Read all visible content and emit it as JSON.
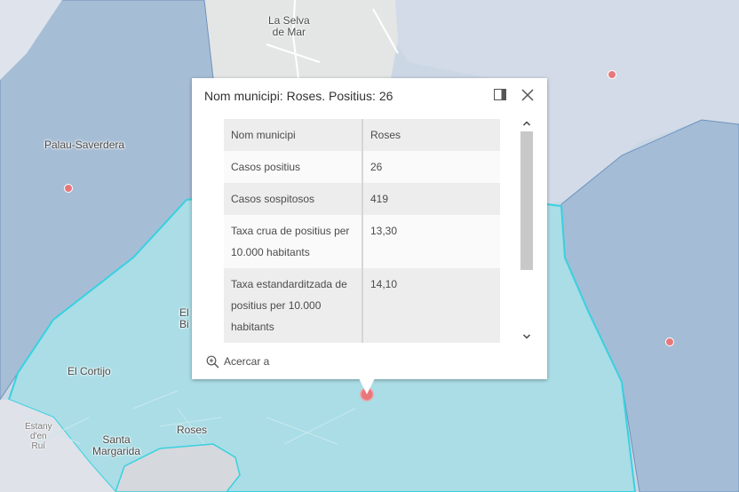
{
  "map": {
    "places": [
      {
        "id": "la-selva-de-mar",
        "name": "La Selva\nde Mar"
      },
      {
        "id": "palau-saverdera",
        "name": "Palau-Saverdera"
      },
      {
        "id": "el-cortijo",
        "name": "El Cortijo"
      },
      {
        "id": "santa-margarida",
        "name": "Santa\nMargarida"
      },
      {
        "id": "roses",
        "name": "Roses"
      },
      {
        "id": "estany-den-rui",
        "name": "Estany\nd'en\nRuí"
      },
      {
        "id": "el-bi",
        "name": "El\nBi"
      }
    ],
    "colors": {
      "highlight_fill": "#aadde6",
      "highlight_stroke": "#38d1e0",
      "municipality_fill": "#a9c0d9",
      "marker": "#e8777a"
    }
  },
  "popup": {
    "title": "Nom municipi: Roses. Positius: 26",
    "rows": [
      {
        "key": "Nom municipi",
        "value": "Roses"
      },
      {
        "key": "Casos positius",
        "value": "26"
      },
      {
        "key": "Casos sospitosos",
        "value": "419"
      },
      {
        "key": "Taxa crua de positius per 10.000 habitants",
        "value": "13,30"
      },
      {
        "key": "Taxa estandarditzada de positius per 10.000 habitants",
        "value": "14,10"
      }
    ],
    "zoom_action": "Acercar a",
    "icons": {
      "dock": "dock-icon",
      "close": "close-icon",
      "zoom": "zoom-in-icon"
    }
  }
}
